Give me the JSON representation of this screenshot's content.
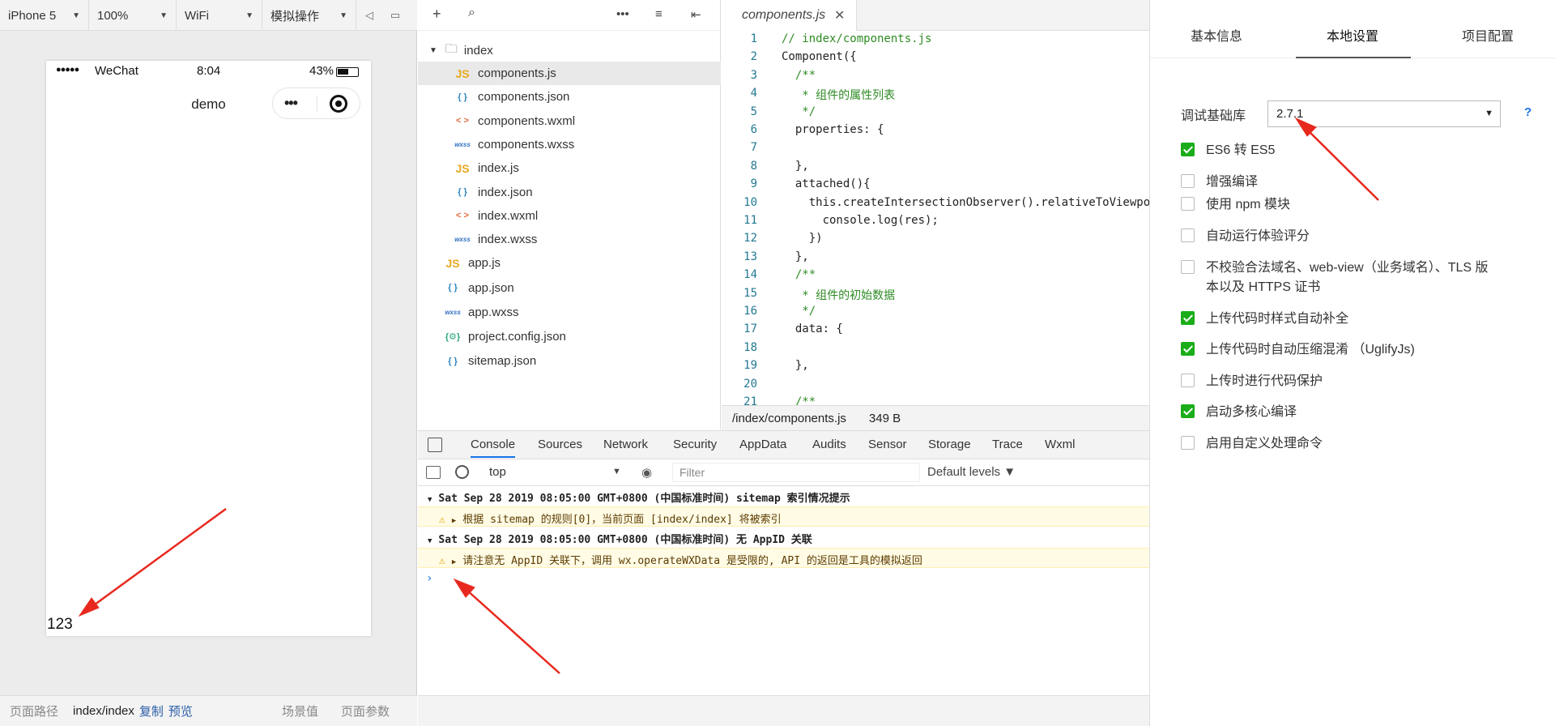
{
  "toolbar": {
    "device": "iPhone 5",
    "zoom": "100%",
    "network": "WiFi",
    "simulate": "模拟操作"
  },
  "phone": {
    "signal": "●●●●●",
    "carrier": "WeChat",
    "time": "8:04",
    "battery": "43%",
    "nav_title": "demo",
    "content_value": "123"
  },
  "sim_footer": {
    "path_label": "页面路径",
    "path": "index/index",
    "copy": "复制",
    "preview": "预览",
    "scene": "场景值",
    "params": "页面参数"
  },
  "tree": {
    "folder": "index",
    "items": [
      {
        "name": "components.js",
        "type": "js"
      },
      {
        "name": "components.json",
        "type": "json"
      },
      {
        "name": "components.wxml",
        "type": "wxml"
      },
      {
        "name": "components.wxss",
        "type": "wxss"
      },
      {
        "name": "index.js",
        "type": "js"
      },
      {
        "name": "index.json",
        "type": "json"
      },
      {
        "name": "index.wxml",
        "type": "wxml"
      },
      {
        "name": "index.wxss",
        "type": "wxss"
      }
    ],
    "root_items": [
      {
        "name": "app.js",
        "type": "js"
      },
      {
        "name": "app.json",
        "type": "json"
      },
      {
        "name": "app.wxss",
        "type": "wxss"
      },
      {
        "name": "project.config.json",
        "type": "cfg"
      },
      {
        "name": "sitemap.json",
        "type": "json"
      }
    ]
  },
  "editor": {
    "tab": "components.js",
    "file_path": "/index/components.js",
    "file_size": "349 B",
    "lines": [
      "// index/components.js",
      "Component({",
      "  /**",
      "   * 组件的属性列表",
      "   */",
      "  properties: {",
      "",
      "  },",
      "  attached(){",
      "    this.createIntersectionObserver().relativeToViewport",
      "      console.log(res);",
      "    })",
      "  },",
      "  /**",
      "   * 组件的初始数据",
      "   */",
      "  data: {",
      "",
      "  },",
      "",
      "  /**"
    ]
  },
  "devtools": {
    "tabs": [
      "Console",
      "Sources",
      "Network",
      "Security",
      "AppData",
      "Audits",
      "Sensor",
      "Storage",
      "Trace",
      "Wxml"
    ],
    "context": "top",
    "filter_placeholder": "Filter",
    "levels": "Default levels ▼",
    "messages": [
      {
        "kind": "group",
        "text": "Sat Sep 28 2019 08:05:00 GMT+0800 (中国标准时间) sitemap 索引情况提示"
      },
      {
        "kind": "warn",
        "text": "根据 sitemap 的规则[0]，当前页面 [index/index] 将被索引"
      },
      {
        "kind": "group",
        "text": "Sat Sep 28 2019 08:05:00 GMT+0800 (中国标准时间) 无 AppID 关联"
      },
      {
        "kind": "warn",
        "text": "请注意无 AppID 关联下，调用 wx.operateWXData 是受限的, API 的返回是工具的模拟返回"
      }
    ]
  },
  "settings": {
    "tabs": [
      "基本信息",
      "本地设置",
      "项目配置"
    ],
    "lib_label": "调试基础库",
    "lib_value": "2.7.1",
    "help": "?",
    "options": [
      {
        "label": "ES6 转 ES5",
        "checked": true
      },
      {
        "label": "增强编译",
        "checked": false
      },
      {
        "label": "使用 npm 模块",
        "checked": false
      },
      {
        "label": "自动运行体验评分",
        "checked": false
      },
      {
        "label": "不校验合法域名、web-view（业务域名）、TLS 版",
        "label2": "本以及 HTTPS 证书",
        "checked": false
      },
      {
        "label": "上传代码时样式自动补全",
        "checked": true
      },
      {
        "label": "上传代码时自动压缩混淆 （UglifyJs)",
        "checked": true
      },
      {
        "label": "上传时进行代码保护",
        "checked": false
      },
      {
        "label": "启动多核心编译",
        "checked": true
      },
      {
        "label": "启用自定义处理命令",
        "checked": false
      }
    ]
  },
  "colors": {
    "arrow": "#e8281e",
    "checkbox_on": "#1aad19",
    "accent": "#1a73e8"
  }
}
